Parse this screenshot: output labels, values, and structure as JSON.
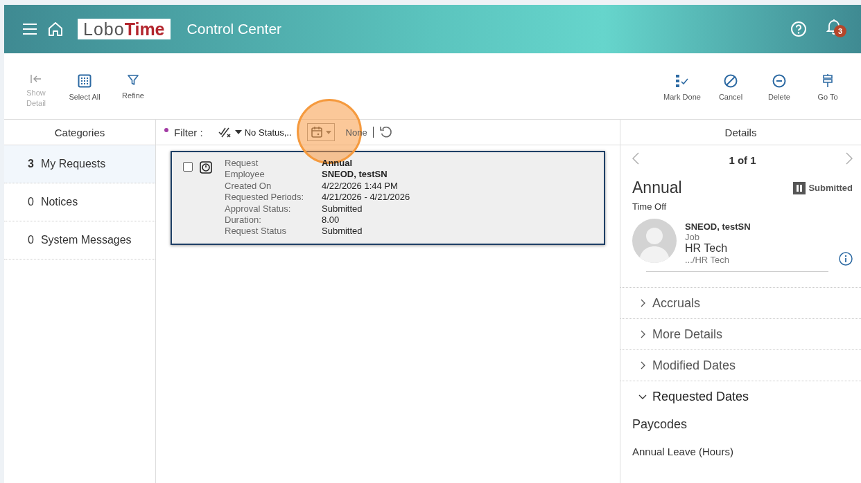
{
  "header": {
    "logo_first": "Lobo",
    "logo_second": "Time",
    "title": "Control Center",
    "notification_count": "3"
  },
  "toolbar_left": [
    {
      "kind": "show-detail",
      "label": "Show Detail",
      "disabled": true
    },
    {
      "kind": "select-all",
      "label": "Select All",
      "disabled": false
    },
    {
      "kind": "refine",
      "label": "Refine",
      "disabled": false
    }
  ],
  "toolbar_right": [
    {
      "kind": "mark-done",
      "label": "Mark Done",
      "disabled": false
    },
    {
      "kind": "cancel",
      "label": "Cancel",
      "disabled": false
    },
    {
      "kind": "delete",
      "label": "Delete",
      "disabled": false
    },
    {
      "kind": "go-to",
      "label": "Go To",
      "disabled": false
    }
  ],
  "categories": {
    "title": "Categories",
    "items": [
      {
        "count": "3",
        "label": "My Requests",
        "selected": true
      },
      {
        "count": "0",
        "label": "Notices",
        "selected": false
      },
      {
        "count": "0",
        "label": "System Messages",
        "selected": false
      }
    ]
  },
  "filter": {
    "label": "Filter :",
    "status": "No Status,..",
    "date_value": "None"
  },
  "requests": [
    {
      "selected": true,
      "checked": false,
      "fields": [
        {
          "label": "Request",
          "value": "Annual",
          "bold": true
        },
        {
          "label": "Employee",
          "value": "SNEOD, testSN",
          "bold": true
        },
        {
          "label": "Created On",
          "value": "4/22/2026 1:44 PM",
          "bold": false
        },
        {
          "label": "Requested Periods:",
          "value": "4/21/2026 - 4/21/2026",
          "bold": false
        },
        {
          "label": "Approval Status:",
          "value": "Submitted",
          "bold": false
        },
        {
          "label": "Duration:",
          "value": "8.00",
          "bold": false
        },
        {
          "label": "Request Status",
          "value": "Submitted",
          "bold": false
        }
      ]
    }
  ],
  "details": {
    "title": "Details",
    "pager": "1 of 1",
    "name": "Annual",
    "status": "Submitted",
    "type": "Time Off",
    "employee": {
      "name": "SNEOD, testSN",
      "job_label": "Job",
      "job": "HR Tech",
      "path": ".../HR Tech"
    },
    "sections": [
      {
        "label": "Accruals",
        "expanded": false
      },
      {
        "label": "More Details",
        "expanded": false
      },
      {
        "label": "Modified Dates",
        "expanded": false
      },
      {
        "label": "Requested Dates",
        "expanded": true
      }
    ],
    "paycodes_title": "Paycodes",
    "paycode": "Annual Leave (Hours)"
  }
}
